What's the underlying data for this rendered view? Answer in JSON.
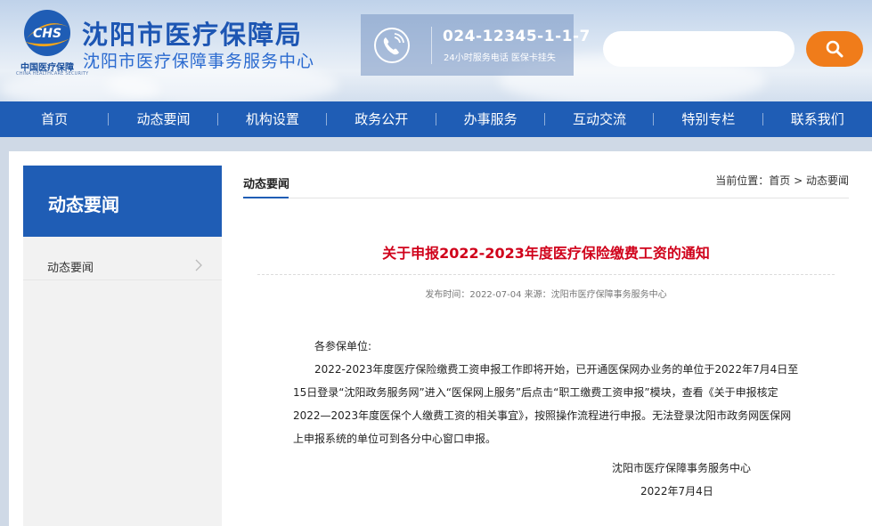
{
  "header": {
    "logo_mark": "CHS",
    "logo_subtitle": "中国医疗保障",
    "logo_subtitle_en": "CHINA HEALTHCARE SECURITY",
    "title_main": "沈阳市医疗保障局",
    "title_sub": "沈阳市医疗保障事务服务中心",
    "hotline_number": "024-12345-1-1-7",
    "hotline_desc": "24小时服务电话  医保卡挂失",
    "search_placeholder": ""
  },
  "nav": {
    "items": [
      "首页",
      "动态要闻",
      "机构设置",
      "政务公开",
      "办事服务",
      "互动交流",
      "特别专栏",
      "联系我们"
    ]
  },
  "sidebar": {
    "title": "动态要闻",
    "items": [
      {
        "label": "动态要闻"
      }
    ]
  },
  "main": {
    "tab_label": "动态要闻",
    "breadcrumb": {
      "prefix": "当前位置：",
      "home": "首页",
      "separator": " > ",
      "current": "动态要闻"
    }
  },
  "article": {
    "title": "关于申报2022-2023年度医疗保险缴费工资的通知",
    "meta": "发布时间：2022-07-04 来源：沈阳市医疗保障事务服务中心",
    "greeting": "各参保单位:",
    "body": "2022-2023年度医疗保险缴费工资申报工作即将开始，已开通医保网办业务的单位于2022年7月4日至15日登录“沈阳政务服务网”进入“医保网上服务”后点击“职工缴费工资申报”模块，查看《关于申报核定2022—2023年度医保个人缴费工资的相关事宜》，按照操作流程进行申报。无法登录沈阳市政务网医保网上申报系统的单位可到各分中心窗口申报。",
    "signature_org": "沈阳市医疗保障事务服务中心",
    "signature_date": "2022年7月4日"
  },
  "colors": {
    "brand_blue": "#1f5db5",
    "search_orange": "#f07c1a",
    "title_red": "#d0021b"
  },
  "icons": {
    "logo": "chs-logo-icon",
    "phone": "phone-icon",
    "search": "search-icon",
    "chevron": "chevron-right-icon"
  }
}
